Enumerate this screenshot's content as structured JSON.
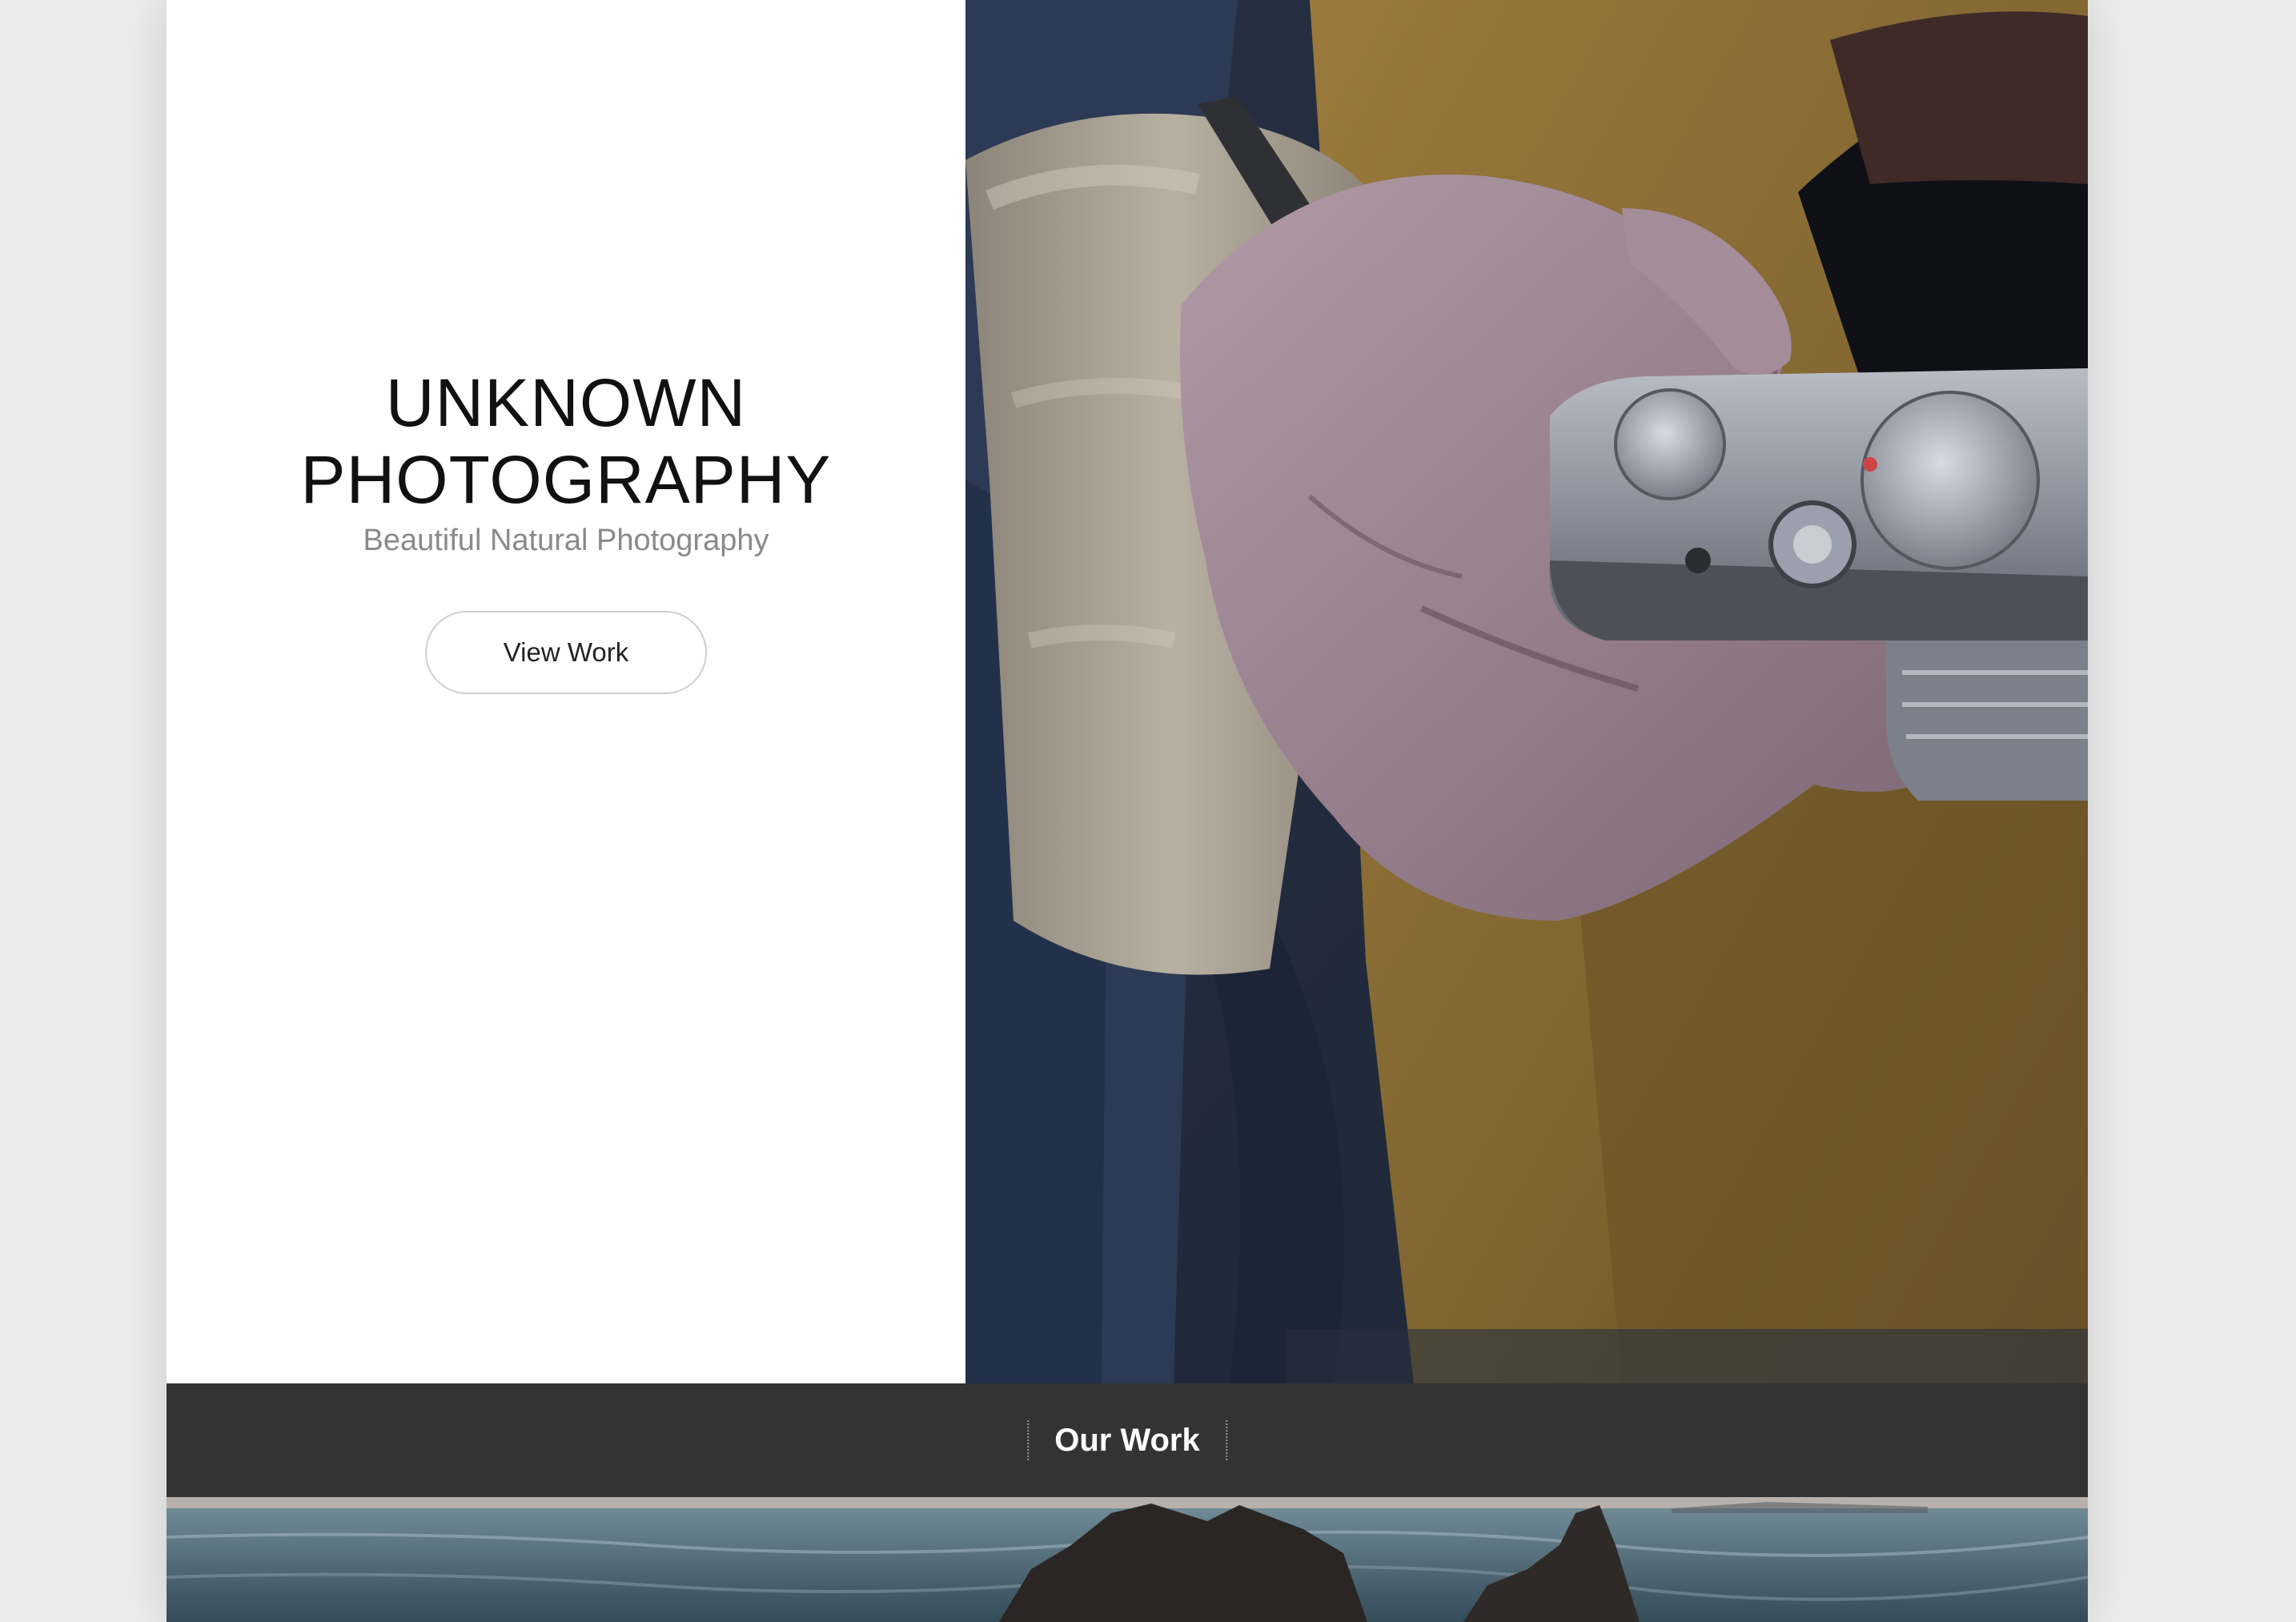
{
  "hero": {
    "title_line1": "UNKNOWN",
    "title_line2": "PHOTOGRAPHY",
    "subtitle": "Beautiful Natural Photography",
    "cta_label": "View Work"
  },
  "section": {
    "title": "Our Work"
  },
  "colors": {
    "page_background": "#ececec",
    "section_bar": "#333333",
    "title_text": "#111111",
    "subtitle_text": "#8a8a8a"
  }
}
